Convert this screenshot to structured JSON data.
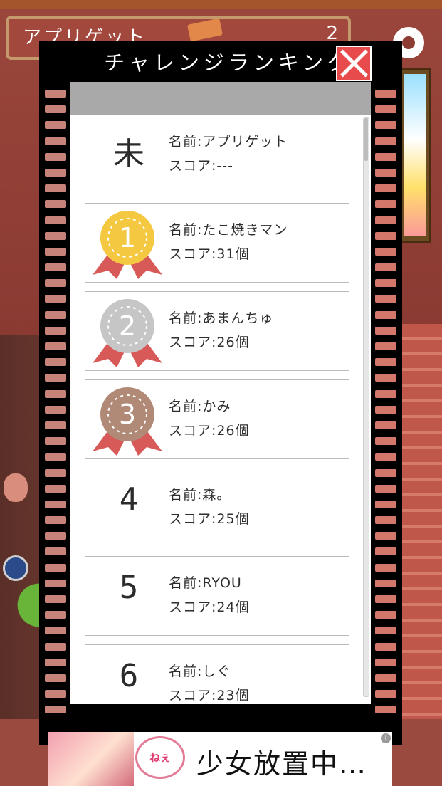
{
  "header": {
    "title": "アプリゲット",
    "count": "2",
    "settings_icon": "gear-icon"
  },
  "modal": {
    "title": "チャレンジランキング",
    "close_icon": "close-icon"
  },
  "ranking": {
    "self": {
      "rank": "未",
      "name": "名前:アプリゲット",
      "score": "スコア:---"
    },
    "entries": [
      {
        "rank": "1",
        "medal": "gold",
        "color": "#f5c842",
        "name": "名前:たこ焼きマン",
        "score": "スコア:31個"
      },
      {
        "rank": "2",
        "medal": "silver",
        "color": "#c6c6c6",
        "name": "名前:あまんちゅ",
        "score": "スコア:26個"
      },
      {
        "rank": "3",
        "medal": "bronze",
        "color": "#b08a76",
        "name": "名前:かみ",
        "score": "スコア:26個"
      },
      {
        "rank": "4",
        "name": "名前:森。",
        "score": "スコア:25個"
      },
      {
        "rank": "5",
        "name": "名前:RYOU",
        "score": "スコア:24個"
      },
      {
        "rank": "6",
        "name": "名前:しぐ",
        "score": "スコア:23個"
      }
    ]
  },
  "ad": {
    "bubble": "ねぇ",
    "text": "少女放置中…",
    "info": "i"
  },
  "colors": {
    "ribbon": "#d85a58",
    "close": "#e84b4b"
  }
}
